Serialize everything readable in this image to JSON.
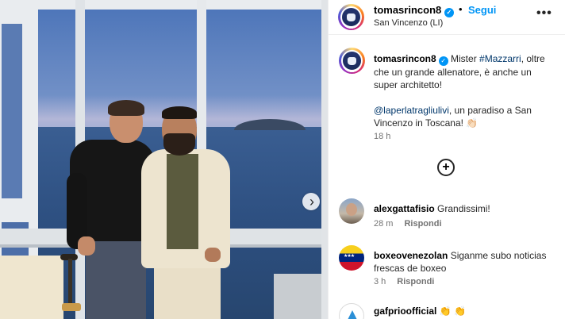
{
  "post": {
    "username": "tomasrincon8",
    "verified_glyph": "✓",
    "dot": "•",
    "follow_label": "Segui",
    "location": "San Vincenzo (LI)",
    "more_icon": "more-options-icon",
    "more_glyph": "•••"
  },
  "caption": {
    "username": "tomasrincon8",
    "line_a": " Mister ",
    "hashtag": "#Mazzarri",
    "line_b": ", oltre che un grande allenatore, è anche un super architetto!",
    "mention": "@laperlatragliulivi",
    "line_c": ", un paradiso a San Vincenzo in Toscana! 👏🏻",
    "time": "18 h"
  },
  "add_comment_glyph": "+",
  "carousel_next_glyph": "›",
  "comments": [
    {
      "username": "alexgattafisio",
      "text": "Grandissimi!",
      "time": "28 m",
      "reply": "Rispondi"
    },
    {
      "username": "boxeovenezolan",
      "text": "Siganme subo noticias frescas de boxeo",
      "time": "3 h",
      "reply": "Rispondi"
    },
    {
      "username": "gafprioofficial",
      "text": "👏 👏"
    }
  ],
  "colors": {
    "follow": "#0095f6",
    "verified": "#0095f6",
    "link": "#00376b",
    "muted": "#737373"
  }
}
